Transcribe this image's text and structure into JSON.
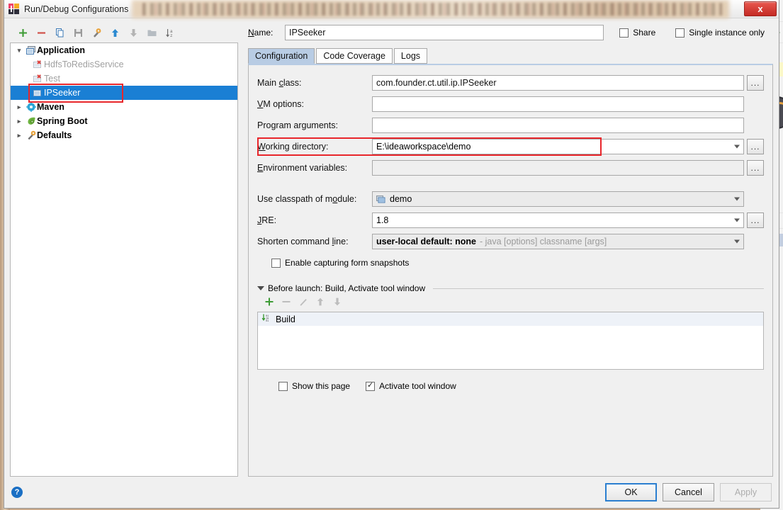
{
  "window": {
    "title": "Run/Debug Configurations",
    "close_label": "x",
    "logo_icon": "intellij-idea-logo"
  },
  "tree_toolbar": {
    "buttons": [
      {
        "name": "add",
        "icon": "plus-icon",
        "tooltip": "Add New Configuration"
      },
      {
        "name": "remove",
        "icon": "minus-icon",
        "tooltip": "Remove Configuration"
      },
      {
        "name": "copy",
        "icon": "copy-icon",
        "tooltip": "Copy Configuration"
      },
      {
        "name": "save",
        "icon": "save-icon",
        "tooltip": "Save Configuration"
      },
      {
        "name": "edit-templates",
        "icon": "wrench-icon",
        "tooltip": "Edit Templates"
      },
      {
        "name": "move-up",
        "icon": "arrow-up-icon",
        "tooltip": "Move Up"
      },
      {
        "name": "move-down",
        "icon": "arrow-down-icon",
        "tooltip": "Move Down"
      },
      {
        "name": "new-folder",
        "icon": "folder-icon",
        "tooltip": "Create New Folder"
      },
      {
        "name": "sort",
        "icon": "sort-az-icon",
        "tooltip": "Sort Configurations"
      }
    ]
  },
  "tree": {
    "nodes": [
      {
        "label": "Application",
        "icon": "application-icon",
        "type": "group",
        "expanded": true,
        "selected": false,
        "invalid": false
      },
      {
        "label": "HdfsToRedisService",
        "icon": "config-error-icon",
        "type": "child",
        "expanded": null,
        "selected": false,
        "invalid": true
      },
      {
        "label": "Test",
        "icon": "config-error-icon",
        "type": "child",
        "expanded": null,
        "selected": false,
        "invalid": true
      },
      {
        "label": "IPSeeker",
        "icon": "config-icon",
        "type": "child",
        "expanded": null,
        "selected": true,
        "invalid": false
      },
      {
        "label": "Maven",
        "icon": "maven-icon",
        "type": "group",
        "expanded": false,
        "selected": false,
        "invalid": false
      },
      {
        "label": "Spring Boot",
        "icon": "spring-boot-icon",
        "type": "group",
        "expanded": false,
        "selected": false,
        "invalid": false
      },
      {
        "label": "Defaults",
        "icon": "defaults-wrench-icon",
        "type": "group",
        "expanded": false,
        "selected": false,
        "invalid": false
      }
    ]
  },
  "header": {
    "name_label": "Name:",
    "name_value": "IPSeeker",
    "share_label": "Share",
    "share_checked": false,
    "single_instance_label": "Single instance only",
    "single_instance_checked": false
  },
  "tabs": [
    {
      "label": "Configuration",
      "active": true
    },
    {
      "label": "Code Coverage",
      "active": false
    },
    {
      "label": "Logs",
      "active": false
    }
  ],
  "configuration": {
    "main_class": {
      "label": "Main class:",
      "value": "com.founder.ct.util.ip.IPSeeker"
    },
    "vm_options": {
      "label": "VM options:",
      "value": ""
    },
    "program_arguments": {
      "label": "Program arguments:",
      "value": ""
    },
    "working_directory": {
      "label": "Working directory:",
      "value": "E:\\ideaworkspace\\demo",
      "highlighted": true
    },
    "environment_variables": {
      "label": "Environment variables:",
      "value": ""
    },
    "use_classpath_of_module": {
      "label": "Use classpath of module:",
      "value": "demo",
      "icon": "module-icon"
    },
    "jre": {
      "label": "JRE:",
      "value": "1.8"
    },
    "shorten_command_line": {
      "label": "Shorten command line:",
      "value": "user-local default: none",
      "value_hint": "- java [options] classname [args]"
    },
    "enable_capturing_form_snapshots": {
      "label": "Enable capturing form snapshots",
      "checked": false
    },
    "browse_button_label": "..."
  },
  "before_launch": {
    "title": "Before launch: Build, Activate tool window",
    "toolbar": [
      {
        "name": "add-task",
        "icon": "plus-icon",
        "enabled": true
      },
      {
        "name": "remove-task",
        "icon": "minus-icon",
        "enabled": false
      },
      {
        "name": "edit-task",
        "icon": "pencil-icon",
        "enabled": false
      },
      {
        "name": "move-up",
        "icon": "arrow-up-icon",
        "enabled": false
      },
      {
        "name": "move-down",
        "icon": "arrow-down-icon",
        "enabled": false
      }
    ],
    "items": [
      {
        "label": "Build",
        "icon": "build-icon"
      }
    ],
    "show_this_page": {
      "label": "Show this page",
      "checked": false
    },
    "activate_tool_window": {
      "label": "Activate tool window",
      "checked": true
    }
  },
  "footer": {
    "help_label": "?",
    "ok_label": "OK",
    "cancel_label": "Cancel",
    "apply_label": "Apply",
    "apply_enabled": false
  },
  "colors": {
    "selection_blue": "#1a7fd4",
    "annotation_red": "#e8262b",
    "tab_active": "#b8cce4",
    "accent_green": "#3d9b35",
    "close_red": "#c42b25"
  }
}
